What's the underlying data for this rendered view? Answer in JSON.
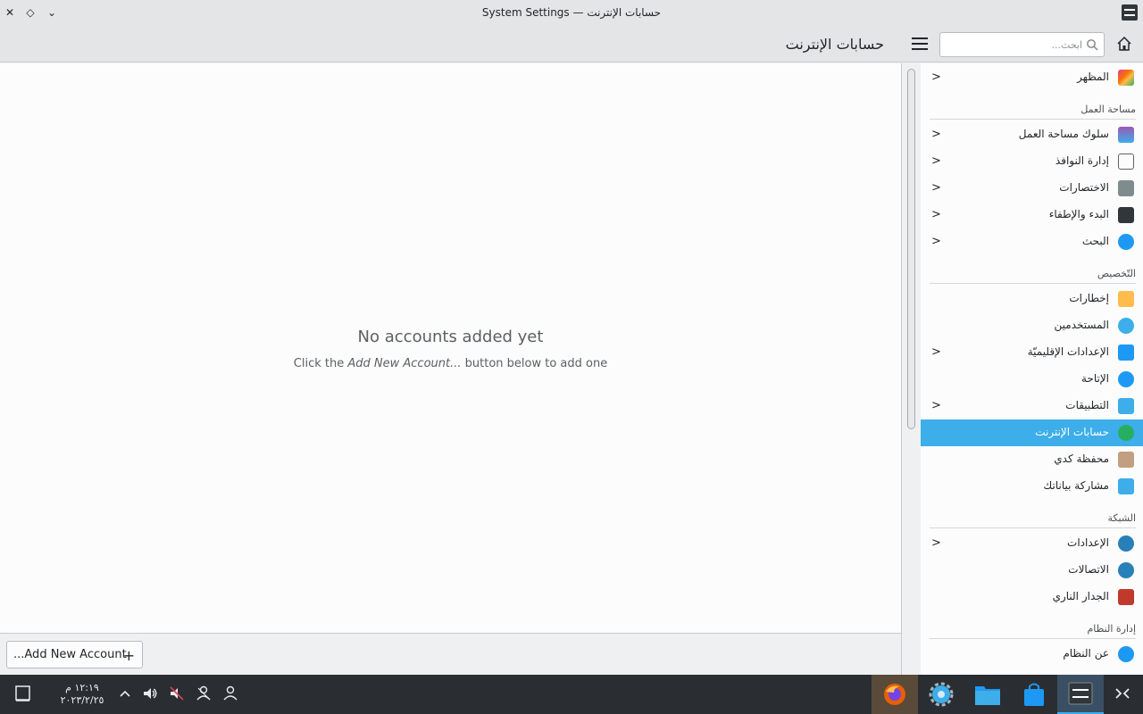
{
  "window": {
    "title": "System Settings — حسابات الإنترنت",
    "close_glyph": "✕",
    "keep_glyph": "◇",
    "menu_glyph": "⌄"
  },
  "header": {
    "page_title": "حسابات الإنترنت",
    "search_placeholder": "ابحث..."
  },
  "main": {
    "empty_title": "No accounts added yet",
    "empty_sub_prefix": "Click the ",
    "empty_sub_emph": "Add New Account...",
    "empty_sub_suffix": " button below to add one",
    "add_button_label": "...Add New Account",
    "add_button_glyph": "+"
  },
  "sidebar": {
    "chevron": "<",
    "items": [
      {
        "label": "المظهر",
        "icon": "appearance-icon",
        "has_children": true
      },
      {
        "label": "سلوك مساحة العمل",
        "icon": "workspace-behavior-icon",
        "has_children": true
      },
      {
        "label": "إدارة النوافذ",
        "icon": "window-management-icon",
        "has_children": true
      },
      {
        "label": "الاختصارات",
        "icon": "keyboard-icon",
        "has_children": true
      },
      {
        "label": "البدء والإطفاء",
        "icon": "startup-icon",
        "has_children": true
      },
      {
        "label": "البحث",
        "icon": "search-icon",
        "has_children": true
      },
      {
        "label": "إخطارات",
        "icon": "bell-icon",
        "has_children": false
      },
      {
        "label": "المستخدمين",
        "icon": "users-icon",
        "has_children": false
      },
      {
        "label": "الإعدادات الإقليميّة",
        "icon": "regional-icon",
        "has_children": true
      },
      {
        "label": "الإتاحة",
        "icon": "accessibility-icon",
        "has_children": false
      },
      {
        "label": "التطبيقات",
        "icon": "applications-icon",
        "has_children": true
      },
      {
        "label": "حسابات الإنترنت",
        "icon": "online-accounts-icon",
        "has_children": false,
        "active": true
      },
      {
        "label": "محفظة كدي",
        "icon": "wallet-icon",
        "has_children": false
      },
      {
        "label": "مشاركة بياناتك",
        "icon": "feedback-icon",
        "has_children": false
      },
      {
        "label": "الإعدادات",
        "icon": "network-settings-icon",
        "has_children": true
      },
      {
        "label": "الاتصالات",
        "icon": "connections-icon",
        "has_children": false
      },
      {
        "label": "الجدار الناري",
        "icon": "firewall-icon",
        "has_children": false
      },
      {
        "label": "عن النظام",
        "icon": "info-icon",
        "has_children": false
      }
    ],
    "sections": {
      "workspace": "مساحة العمل",
      "personalization": "التّخصيص",
      "network": "الشبكة",
      "system": "إدارة النظام"
    }
  },
  "taskbar": {
    "clock_time": "١٢:١٩ م",
    "clock_date": "٢٠٢٣/٢/٢٥"
  },
  "colors": {
    "accent": "#3daee9",
    "panel": "#2a2e32"
  }
}
